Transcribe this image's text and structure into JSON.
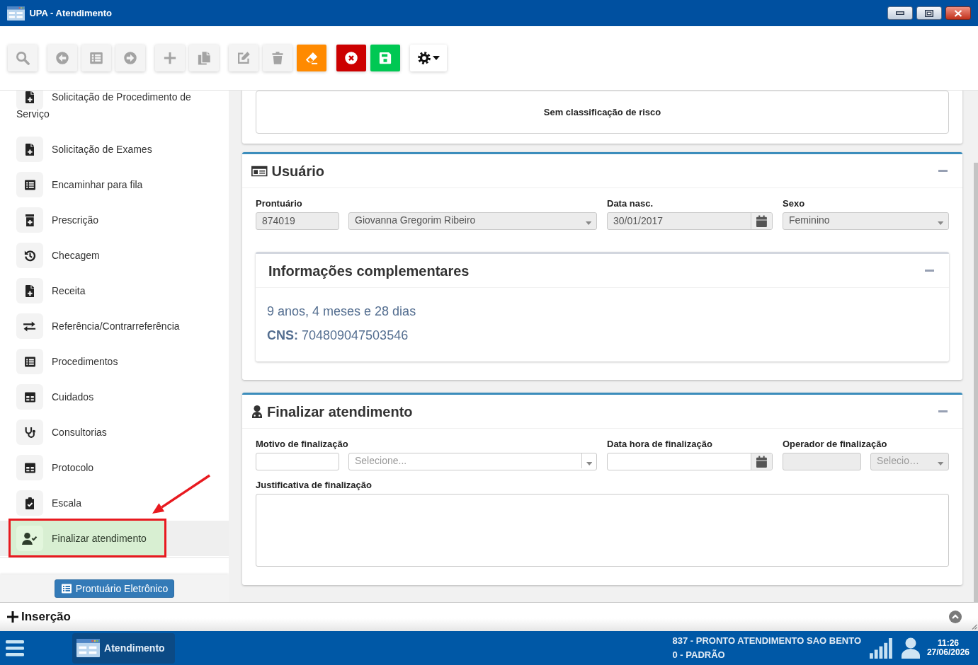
{
  "window": {
    "title": "UPA - Atendimento"
  },
  "toolbar": {
    "groups": [
      {
        "buttons": [
          {
            "kind": "search",
            "disabled": true
          }
        ]
      },
      {
        "buttons": [
          {
            "kind": "previous",
            "disabled": true
          },
          {
            "kind": "list",
            "disabled": true
          },
          {
            "kind": "next",
            "disabled": true
          }
        ]
      },
      {
        "buttons": [
          {
            "kind": "add",
            "disabled": true
          },
          {
            "kind": "copy",
            "disabled": true
          }
        ]
      },
      {
        "buttons": [
          {
            "kind": "edit",
            "disabled": true
          },
          {
            "kind": "delete",
            "disabled": true
          },
          {
            "kind": "clear",
            "disabled": false,
            "color": "#ff8a00"
          }
        ]
      },
      {
        "buttons": [
          {
            "kind": "cancel",
            "disabled": false,
            "color": "#cc0000"
          },
          {
            "kind": "save",
            "disabled": false,
            "color": "#00c853"
          }
        ]
      },
      {
        "buttons": [
          {
            "kind": "settings",
            "disabled": false,
            "color": "#ffffff"
          }
        ]
      }
    ]
  },
  "sidebar": {
    "items": [
      {
        "label": "Solicitação de Procedimento de Serviço",
        "kind": "file-plus",
        "selected": false,
        "highlighted": false
      },
      {
        "label": "Solicitação de Exames",
        "kind": "file-plus",
        "selected": false,
        "highlighted": false
      },
      {
        "label": "Encaminhar para fila",
        "kind": "list",
        "selected": false,
        "highlighted": false
      },
      {
        "label": "Prescrição",
        "kind": "prescription",
        "selected": false,
        "highlighted": false
      },
      {
        "label": "Checagem",
        "kind": "history",
        "selected": false,
        "highlighted": false
      },
      {
        "label": "Receita",
        "kind": "file-plus",
        "selected": false,
        "highlighted": false
      },
      {
        "label": "Referência/Contrarreferência",
        "kind": "exchange",
        "selected": false,
        "highlighted": false
      },
      {
        "label": "Procedimentos",
        "kind": "list",
        "selected": false,
        "highlighted": false
      },
      {
        "label": "Cuidados",
        "kind": "table",
        "selected": false,
        "highlighted": false
      },
      {
        "label": "Consultorias",
        "kind": "stethoscope",
        "selected": false,
        "highlighted": false
      },
      {
        "label": "Protocolo",
        "kind": "table",
        "selected": false,
        "highlighted": false
      },
      {
        "label": "Escala",
        "kind": "clipboard-check",
        "selected": false,
        "highlighted": false
      },
      {
        "label": "Finalizar atendimento",
        "kind": "user-check",
        "selected": true,
        "highlighted": true
      }
    ],
    "footer_button": {
      "label": "Prontuário Eletrônico"
    }
  },
  "risk_panel": {
    "text": "Sem classificação de risco"
  },
  "user_panel": {
    "title": "Usuário",
    "rows": [
      [
        {
          "label": "Prontuário",
          "controls": [
            {
              "kind": "input",
              "value": "874019",
              "disabled": true
            },
            {
              "kind": "select",
              "value": "Giovanna Gregorim Ribeiro",
              "disabled": true
            }
          ]
        },
        {
          "label": "Data nasc.",
          "controls": [
            {
              "kind": "date",
              "value": "30/01/2017",
              "disabled": true
            }
          ]
        },
        {
          "label": "Sexo",
          "controls": [
            {
              "kind": "select",
              "value": "Feminino",
              "disabled": true
            }
          ]
        }
      ]
    ],
    "complement": {
      "title": "Informações complementares",
      "age": "9 anos, 4 meses e 28 dias",
      "cns": "**CNS:** 704809047503546"
    }
  },
  "finish_panel": {
    "title": "Finalizar atendimento",
    "rows": [
      [
        {
          "label": "Motivo de finalização",
          "controls": [
            {
              "kind": "input",
              "disabled": false
            },
            {
              "kind": "select",
              "placeholder": "Selecione...",
              "disabled": false
            }
          ]
        },
        {
          "label": "Data hora de finalização",
          "controls": [
            {
              "kind": "date",
              "disabled": false
            }
          ]
        },
        {
          "label": "Operador de finalização",
          "controls": [
            {
              "kind": "input",
              "disabled": true
            },
            {
              "kind": "select",
              "placeholder": "Selecio…",
              "disabled": true
            }
          ]
        }
      ],
      [
        {
          "label": "Justificativa de finalização",
          "controls": [
            {
              "kind": "textarea",
              "disabled": false
            }
          ]
        }
      ]
    ]
  },
  "insert_bar": {
    "label": "Inserção"
  },
  "taskbar": {
    "tasks": [
      {
        "label": "Atendimento",
        "selected": true
      }
    ],
    "unit": "837 - PRONTO ATENDIMENTO SAO BENTO",
    "profile": "0 - PADRÃO",
    "time": "11:26",
    "date": "27/06/2026"
  }
}
